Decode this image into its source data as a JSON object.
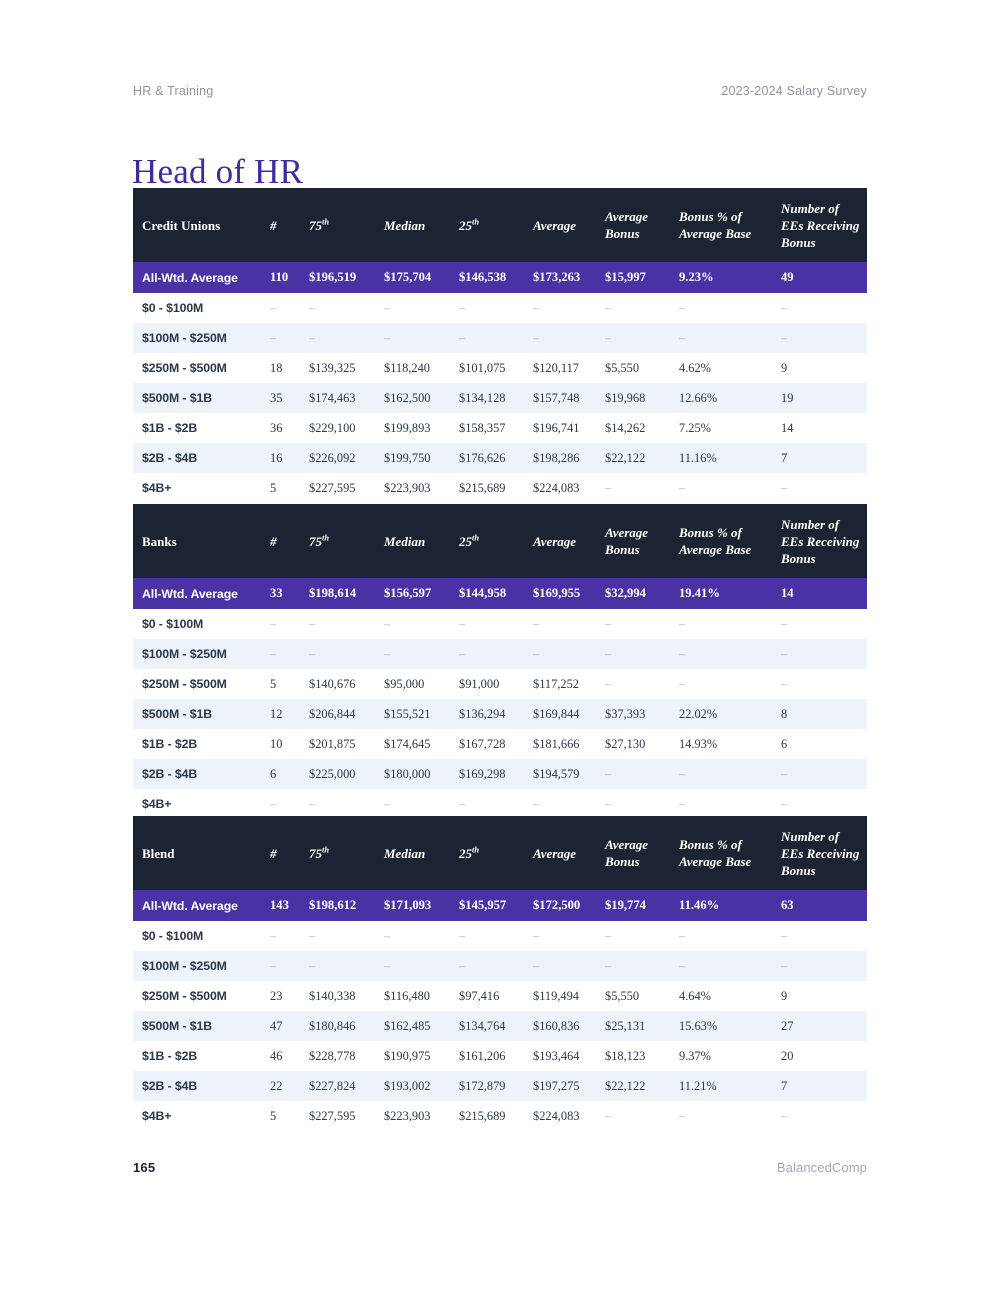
{
  "runhead": {
    "left": "HR & Training",
    "right": "2023-2024 Salary Survey"
  },
  "title": "Head of HR",
  "footer": {
    "page_number": "165",
    "brand": "BalancedComp"
  },
  "colors": {
    "title": "#3b2d9e",
    "table_header_bg": "#1c2433",
    "highlight_row_bg": "#4a32a5",
    "stripe_bg": "#eef2fa",
    "body_text": "#2c3747",
    "muted_text": "#8e949e"
  },
  "columns": {
    "num": "#",
    "p75_base": "75",
    "p75_sup": "th",
    "median": "Median",
    "p25_base": "25",
    "p25_sup": "th",
    "average": "Average",
    "average_bonus": "Average\nBonus",
    "bonus_pct": "Bonus % of\nAverage Base",
    "ees_bonus": "Number of\nEEs Receiving\nBonus"
  },
  "tables": [
    {
      "name": "Credit Unions",
      "rows": [
        {
          "label": "All-Wtd. Average",
          "highlight": true,
          "cells": [
            "110",
            "$196,519",
            "$175,704",
            "$146,538",
            "$173,263",
            "$15,997",
            "9.23%",
            "49"
          ]
        },
        {
          "label": "$0 - $100M",
          "highlight": false,
          "cells": [
            "–",
            "–",
            "–",
            "–",
            "–",
            "–",
            "–",
            "–"
          ]
        },
        {
          "label": "$100M - $250M",
          "highlight": false,
          "cells": [
            "–",
            "–",
            "–",
            "–",
            "–",
            "–",
            "–",
            "–"
          ]
        },
        {
          "label": "$250M - $500M",
          "highlight": false,
          "cells": [
            "18",
            "$139,325",
            "$118,240",
            "$101,075",
            "$120,117",
            "$5,550",
            "4.62%",
            "9"
          ]
        },
        {
          "label": "$500M - $1B",
          "highlight": false,
          "cells": [
            "35",
            "$174,463",
            "$162,500",
            "$134,128",
            "$157,748",
            "$19,968",
            "12.66%",
            "19"
          ]
        },
        {
          "label": "$1B - $2B",
          "highlight": false,
          "cells": [
            "36",
            "$229,100",
            "$199,893",
            "$158,357",
            "$196,741",
            "$14,262",
            "7.25%",
            "14"
          ]
        },
        {
          "label": "$2B - $4B",
          "highlight": false,
          "cells": [
            "16",
            "$226,092",
            "$199,750",
            "$176,626",
            "$198,286",
            "$22,122",
            "11.16%",
            "7"
          ]
        },
        {
          "label": "$4B+",
          "highlight": false,
          "cells": [
            "5",
            "$227,595",
            "$223,903",
            "$215,689",
            "$224,083",
            "–",
            "–",
            "–"
          ]
        }
      ]
    },
    {
      "name": "Banks",
      "rows": [
        {
          "label": "All-Wtd. Average",
          "highlight": true,
          "cells": [
            "33",
            "$198,614",
            "$156,597",
            "$144,958",
            "$169,955",
            "$32,994",
            "19.41%",
            "14"
          ]
        },
        {
          "label": "$0 - $100M",
          "highlight": false,
          "cells": [
            "–",
            "–",
            "–",
            "–",
            "–",
            "–",
            "–",
            "–"
          ]
        },
        {
          "label": "$100M - $250M",
          "highlight": false,
          "cells": [
            "–",
            "–",
            "–",
            "–",
            "–",
            "–",
            "–",
            "–"
          ]
        },
        {
          "label": "$250M - $500M",
          "highlight": false,
          "cells": [
            "5",
            "$140,676",
            "$95,000",
            "$91,000",
            "$117,252",
            "–",
            "–",
            "–"
          ]
        },
        {
          "label": "$500M - $1B",
          "highlight": false,
          "cells": [
            "12",
            "$206,844",
            "$155,521",
            "$136,294",
            "$169,844",
            "$37,393",
            "22.02%",
            "8"
          ]
        },
        {
          "label": "$1B - $2B",
          "highlight": false,
          "cells": [
            "10",
            "$201,875",
            "$174,645",
            "$167,728",
            "$181,666",
            "$27,130",
            "14.93%",
            "6"
          ]
        },
        {
          "label": "$2B - $4B",
          "highlight": false,
          "cells": [
            "6",
            "$225,000",
            "$180,000",
            "$169,298",
            "$194,579",
            "–",
            "–",
            "–"
          ]
        },
        {
          "label": "$4B+",
          "highlight": false,
          "cells": [
            "–",
            "–",
            "–",
            "–",
            "–",
            "–",
            "–",
            "–"
          ]
        }
      ]
    },
    {
      "name": "Blend",
      "rows": [
        {
          "label": "All-Wtd. Average",
          "highlight": true,
          "cells": [
            "143",
            "$198,612",
            "$171,093",
            "$145,957",
            "$172,500",
            "$19,774",
            "11.46%",
            "63"
          ]
        },
        {
          "label": "$0 - $100M",
          "highlight": false,
          "cells": [
            "–",
            "–",
            "–",
            "–",
            "–",
            "–",
            "–",
            "–"
          ]
        },
        {
          "label": "$100M - $250M",
          "highlight": false,
          "cells": [
            "–",
            "–",
            "–",
            "–",
            "–",
            "–",
            "–",
            "–"
          ]
        },
        {
          "label": "$250M - $500M",
          "highlight": false,
          "cells": [
            "23",
            "$140,338",
            "$116,480",
            "$97,416",
            "$119,494",
            "$5,550",
            "4.64%",
            "9"
          ]
        },
        {
          "label": "$500M - $1B",
          "highlight": false,
          "cells": [
            "47",
            "$180,846",
            "$162,485",
            "$134,764",
            "$160,836",
            "$25,131",
            "15.63%",
            "27"
          ]
        },
        {
          "label": "$1B - $2B",
          "highlight": false,
          "cells": [
            "46",
            "$228,778",
            "$190,975",
            "$161,206",
            "$193,464",
            "$18,123",
            "9.37%",
            "20"
          ]
        },
        {
          "label": "$2B - $4B",
          "highlight": false,
          "cells": [
            "22",
            "$227,824",
            "$193,002",
            "$172,879",
            "$197,275",
            "$22,122",
            "11.21%",
            "7"
          ]
        },
        {
          "label": "$4B+",
          "highlight": false,
          "cells": [
            "5",
            "$227,595",
            "$223,903",
            "$215,689",
            "$224,083",
            "–",
            "–",
            "–"
          ]
        }
      ]
    }
  ]
}
